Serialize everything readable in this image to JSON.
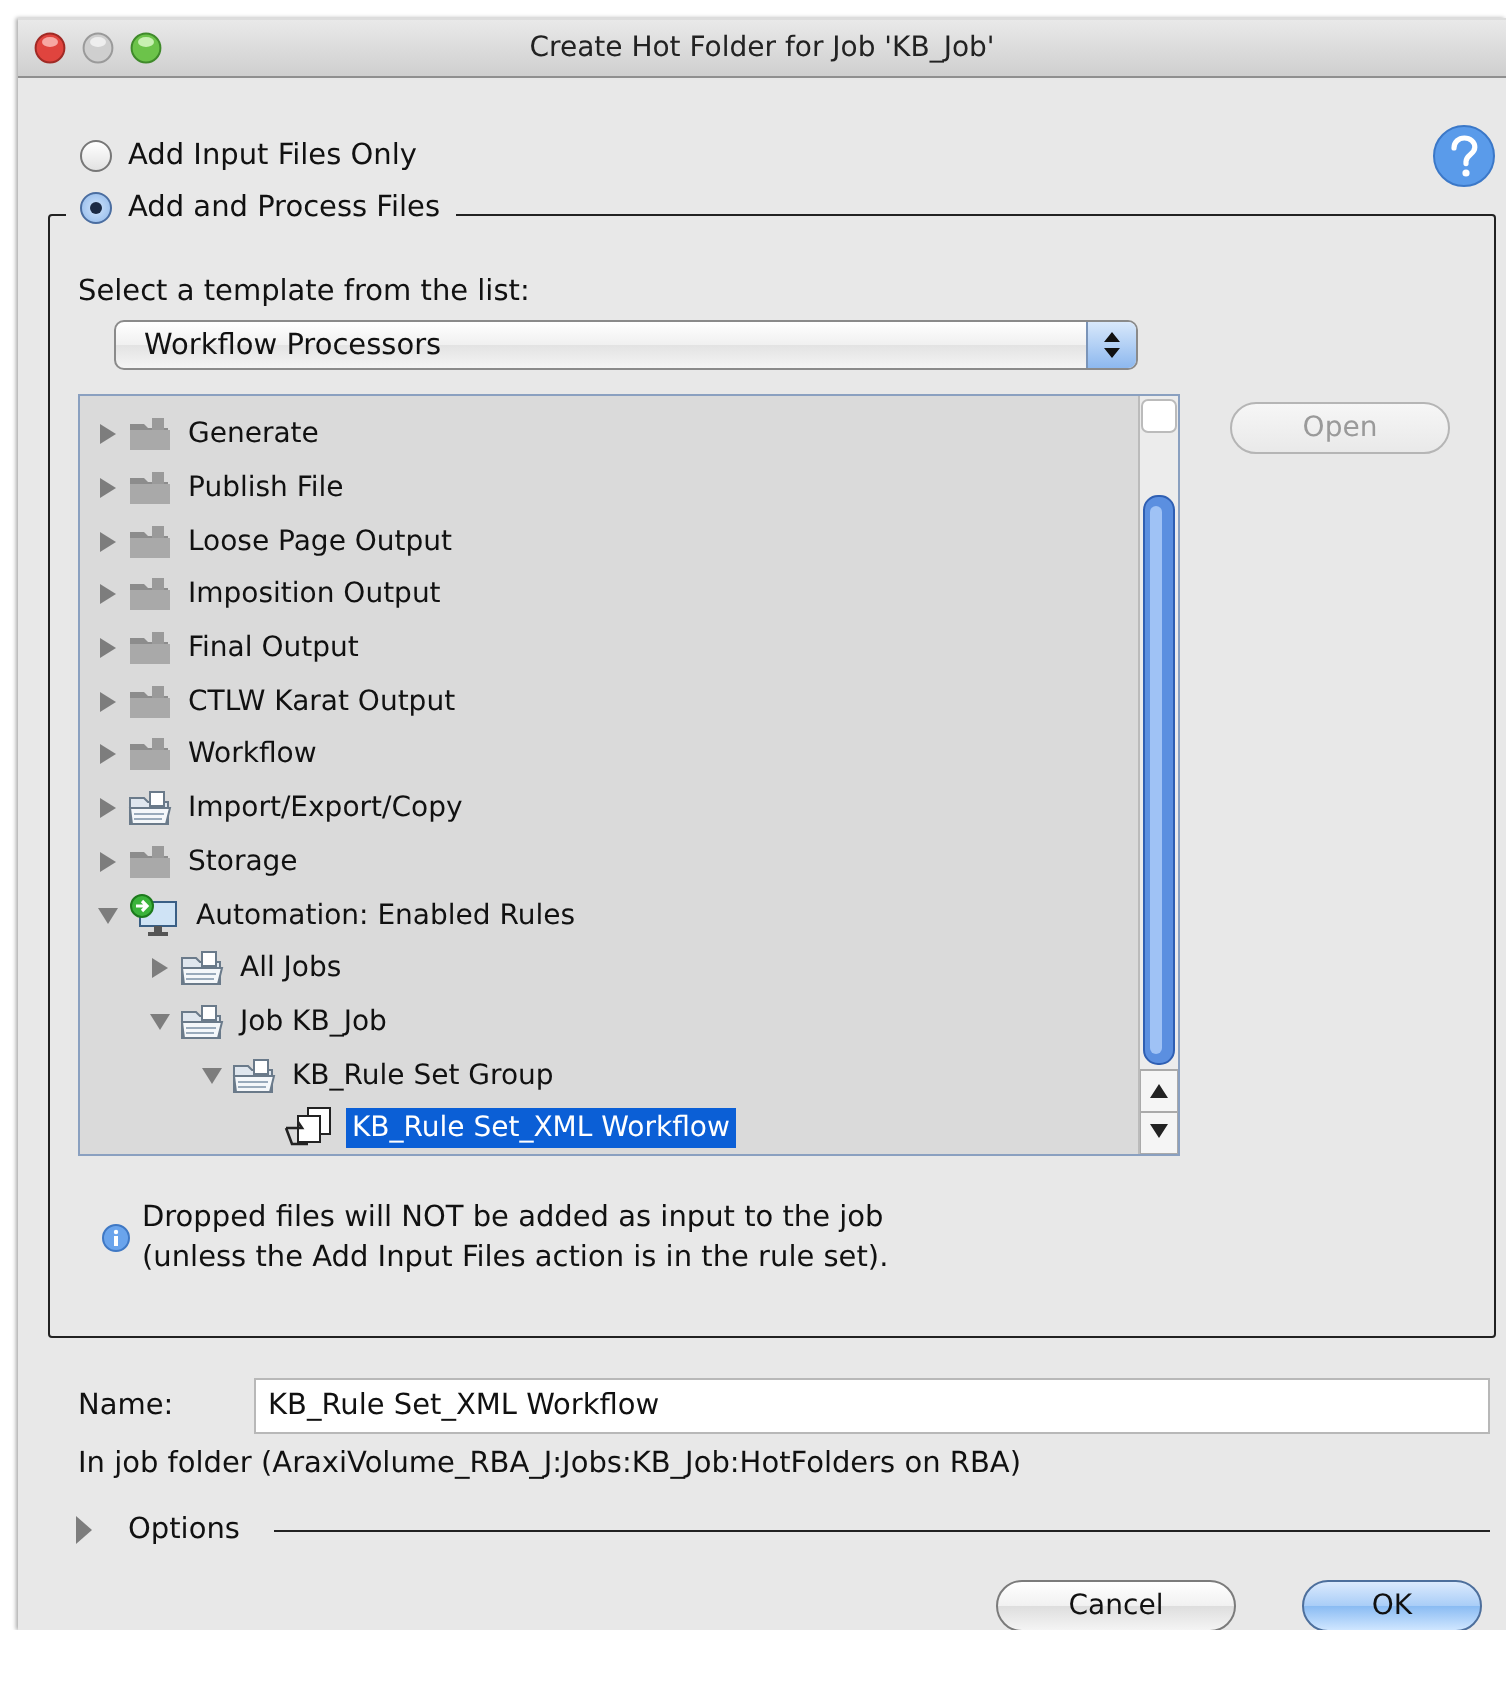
{
  "window": {
    "title": "Create Hot Folder for Job 'KB_Job'"
  },
  "modes": [
    {
      "label": "Add Input Files Only",
      "selected": false
    },
    {
      "label": "Add and Process Files",
      "selected": true
    }
  ],
  "template": {
    "label": "Select a template from the list:",
    "value": "Workflow Processors"
  },
  "tree": {
    "items": [
      {
        "label": "Generate",
        "kind": "folder",
        "expanded": false,
        "selected": false
      },
      {
        "label": "Publish File",
        "kind": "folder",
        "expanded": false,
        "selected": false
      },
      {
        "label": "Loose Page Output",
        "kind": "folder",
        "expanded": false,
        "selected": false
      },
      {
        "label": "Imposition Output",
        "kind": "folder",
        "expanded": false,
        "selected": false
      },
      {
        "label": "Final Output",
        "kind": "folder",
        "expanded": false,
        "selected": false
      },
      {
        "label": "CTLW Karat Output",
        "kind": "folder",
        "expanded": false,
        "selected": false
      },
      {
        "label": "Workflow",
        "kind": "folder",
        "expanded": false,
        "selected": false
      },
      {
        "label": "Import/Export/Copy",
        "kind": "shared",
        "expanded": false,
        "selected": false
      },
      {
        "label": "Storage",
        "kind": "folder",
        "expanded": false,
        "selected": false
      },
      {
        "label": "Automation: Enabled Rules",
        "kind": "automation",
        "expanded": true,
        "selected": false,
        "children": [
          {
            "label": "All Jobs",
            "kind": "shared",
            "expanded": false,
            "selected": false
          },
          {
            "label": "Job KB_Job",
            "kind": "shared",
            "expanded": true,
            "selected": false,
            "children": [
              {
                "label": "KB_Rule Set Group",
                "kind": "shared",
                "expanded": true,
                "selected": false,
                "children": [
                  {
                    "label": "KB_Rule Set_XML Workflow",
                    "kind": "rule",
                    "selected": true
                  }
                ]
              }
            ]
          }
        ]
      }
    ]
  },
  "open_button": {
    "label": "Open",
    "disabled": true
  },
  "note": "Dropped files will NOT be added as input to the job\n(unless the Add Input Files action is in the rule set).",
  "name": {
    "label": "Name:",
    "value": "KB_Rule Set_XML Workflow"
  },
  "location": "In job folder (AraxiVolume_RBA_J:Jobs:KB_Job:HotFolders on RBA)",
  "options": {
    "label": "Options",
    "expanded": false
  },
  "buttons": [
    {
      "label": "Cancel",
      "kind": "normal"
    },
    {
      "label": "OK",
      "kind": "default"
    }
  ]
}
